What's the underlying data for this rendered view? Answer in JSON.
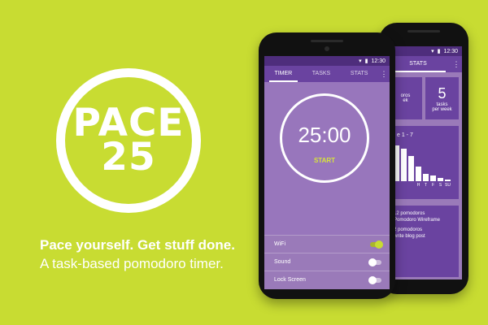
{
  "brand": {
    "logo_line1": "PACE",
    "logo_line2": "25",
    "tagline1": "Pace yourself. Get stuff done.",
    "tagline2": "A task-based pomodoro timer.",
    "colors": {
      "background": "#c8dc32",
      "accent_purple": "#6a43a0",
      "screen_purple": "#9876bc",
      "start_yellow": "#d7e53a"
    }
  },
  "front_phone": {
    "status_time": "12:30",
    "tabs": [
      {
        "label": "TIMER",
        "active": true
      },
      {
        "label": "TASKS",
        "active": false
      },
      {
        "label": "STATS",
        "active": false
      }
    ],
    "menu_icon": "more-vert-icon",
    "timer": {
      "value": "25:00",
      "start_label": "START"
    },
    "settings": [
      {
        "label": "WiFi",
        "on": true
      },
      {
        "label": "Sound",
        "on": false
      },
      {
        "label": "Lock Screen",
        "on": false
      }
    ]
  },
  "back_phone": {
    "status_time": "12:30",
    "tab_label": "STATS",
    "card_left": {
      "value": "",
      "line1": "oros",
      "line2": "ek"
    },
    "card_right": {
      "value": "5",
      "line1": "tasks",
      "line2": "per week"
    },
    "chart_title": "e 1 - 7",
    "chart_data": {
      "type": "bar",
      "categories": [
        "",
        "",
        "",
        "H",
        "T",
        "F",
        "S",
        "SU"
      ],
      "values": [
        10,
        9,
        7,
        4,
        2,
        1.5,
        1,
        0.5
      ]
    },
    "list": [
      {
        "title": "12 pomodoros",
        "subtitle": "Pomodoro Wireframe"
      },
      {
        "title": "2 pomodoros",
        "subtitle": "write blog post"
      }
    ]
  }
}
